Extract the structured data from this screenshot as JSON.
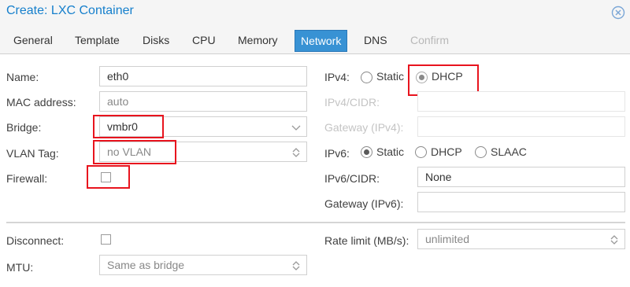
{
  "dialog": {
    "title": "Create: LXC Container"
  },
  "tabs": [
    {
      "label": "General"
    },
    {
      "label": "Template"
    },
    {
      "label": "Disks"
    },
    {
      "label": "CPU"
    },
    {
      "label": "Memory"
    },
    {
      "label": "Network",
      "active": true
    },
    {
      "label": "DNS"
    },
    {
      "label": "Confirm",
      "disabled": true
    }
  ],
  "left": {
    "name": {
      "label": "Name:",
      "value": "eth0"
    },
    "mac": {
      "label": "MAC address:",
      "placeholder": "auto"
    },
    "bridge": {
      "label": "Bridge:",
      "value": "vmbr0"
    },
    "vlan": {
      "label": "VLAN Tag:",
      "placeholder": "no VLAN"
    },
    "firewall": {
      "label": "Firewall:",
      "checked": false
    }
  },
  "right": {
    "ipv4": {
      "label": "IPv4:",
      "options": [
        "Static",
        "DHCP"
      ],
      "selected": "DHCP"
    },
    "ipv4_cidr": {
      "label": "IPv4/CIDR:",
      "value": ""
    },
    "gateway_ipv4": {
      "label": "Gateway (IPv4):",
      "value": ""
    },
    "ipv6": {
      "label": "IPv6:",
      "options": [
        "Static",
        "DHCP",
        "SLAAC"
      ],
      "selected": "Static"
    },
    "ipv6_cidr": {
      "label": "IPv6/CIDR:",
      "value": "None"
    },
    "gateway_ipv6": {
      "label": "Gateway (IPv6):",
      "value": ""
    }
  },
  "bottom": {
    "disconnect": {
      "label": "Disconnect:",
      "checked": false
    },
    "mtu": {
      "label": "MTU:",
      "placeholder": "Same as bridge"
    },
    "rate_limit": {
      "label": "Rate limit (MB/s):",
      "placeholder": "unlimited"
    }
  },
  "colors": {
    "accent": "#157fcc",
    "active_tab": "#3892d4",
    "highlight": "#e8141e"
  }
}
